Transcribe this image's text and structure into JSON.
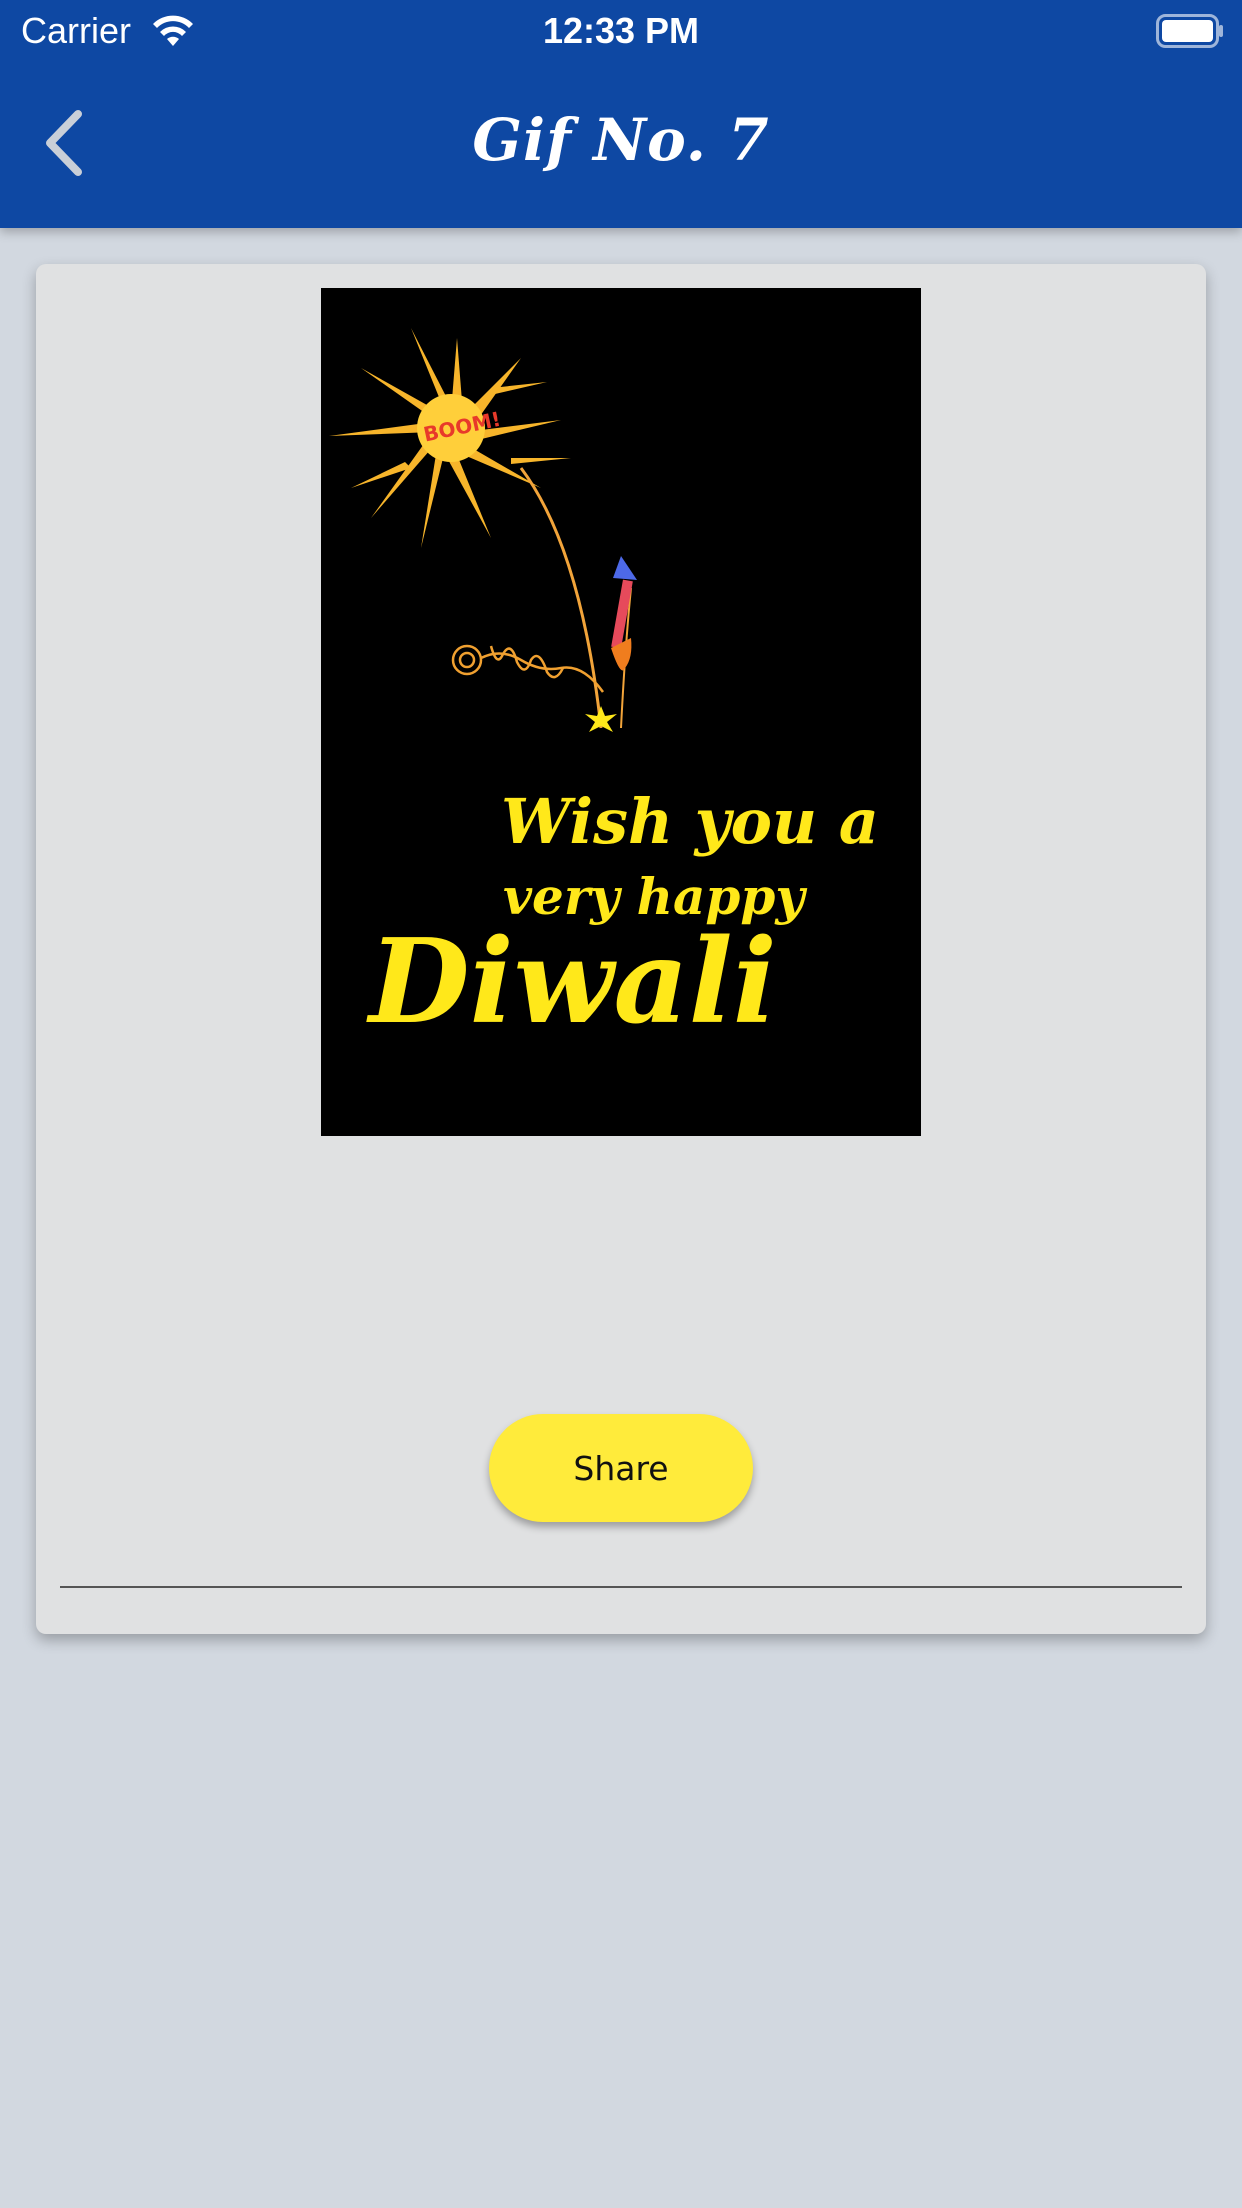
{
  "status_bar": {
    "carrier": "Carrier",
    "time": "12:33 PM"
  },
  "nav": {
    "title": "Gif No. 7",
    "back_icon": "chevron-left-icon"
  },
  "gif": {
    "alt": "Wish you a very happy Diwali",
    "line1": "Wish you a",
    "line2": "very happy",
    "line3": "Diwali",
    "burst_text": "BOOM!"
  },
  "actions": {
    "share_label": "Share"
  },
  "colors": {
    "header": "#0e48a3",
    "background": "#d2d8e0",
    "card": "#e0e1e2",
    "share_button": "#ffeb3b",
    "gif_text": "#ffe81a"
  }
}
